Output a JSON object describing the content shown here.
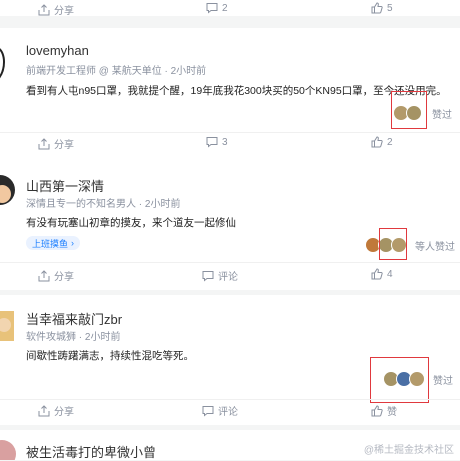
{
  "top_bar": {
    "share": "分享",
    "comments": "2",
    "likes": "5"
  },
  "posts": [
    {
      "username": "lovemyhan",
      "meta": "前端开发工程师 @ 某航天单位 · 2小时前",
      "content": "看到有人屯n95口罩，我就提个醒，19年底我花300块买的50个KN95口罩，至今还没用完。",
      "like_text": "赞过",
      "actions": {
        "share": "分享",
        "comments": "3",
        "likes": "2"
      }
    },
    {
      "username": "山西第一深情",
      "meta": "深情且专一的不知名男人 · 2小时前",
      "content": "有没有玩塞山初章的摸友，来个道友一起修仙",
      "tag": "上班摸鱼",
      "like_text": "等人赞过",
      "actions": {
        "share": "分享",
        "comments": "评论",
        "likes": "4"
      }
    },
    {
      "username": "当幸福来敲门zbr",
      "meta": "软件攻城狮 · 2小时前",
      "content": "间歇性踌躇满志，持续性混吃等死。",
      "like_text": "赞过",
      "actions": {
        "share": "分享",
        "comments": "评论",
        "likes": "赞"
      }
    },
    {
      "username": "被生活毒打的卑微小曾"
    }
  ],
  "watermark": "@稀土掘金技术社区",
  "colors": {
    "accent": "#1e80ff",
    "highlight_box": "#e0393e",
    "meta": "#8a919f"
  }
}
